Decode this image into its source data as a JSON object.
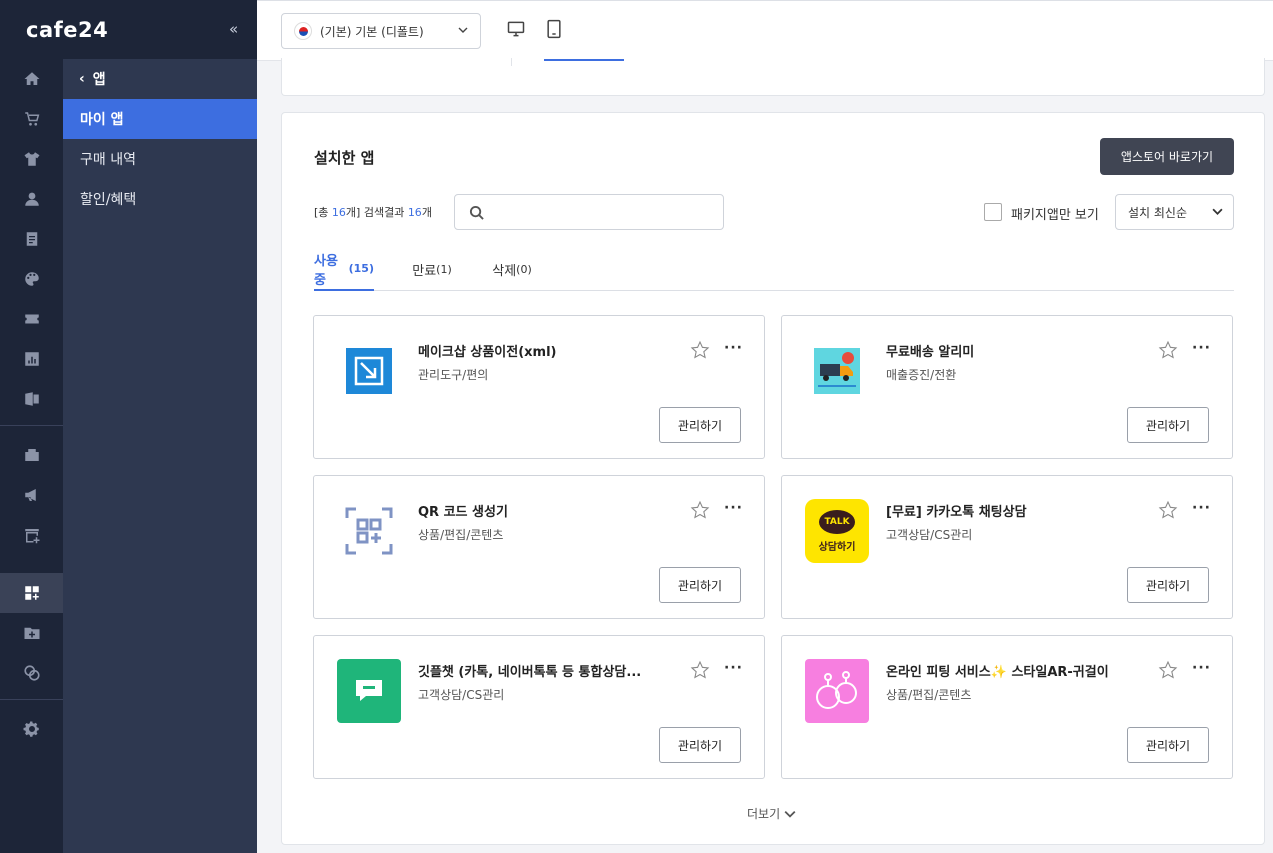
{
  "brand": {
    "logo": "cafe24",
    "collapse_glyph": "«"
  },
  "rail": {
    "icons": [
      "home-icon",
      "cart-icon",
      "shirt-icon",
      "user-icon",
      "document-icon",
      "palette-icon",
      "coupon-icon",
      "chart-icon",
      "excel-icon",
      "store-icon",
      "megaphone-icon",
      "shop-add-icon",
      "apps-icon",
      "folder-add-icon",
      "layers-icon",
      "gear-icon"
    ],
    "active": "apps-icon"
  },
  "subnav": {
    "back_label": "앱",
    "items": [
      {
        "label": "마이 앱",
        "active": true
      },
      {
        "label": "구매 내역",
        "active": false
      },
      {
        "label": "할인/혜택",
        "active": false
      }
    ]
  },
  "topbar": {
    "language_select": "(기본) 기본 (디폴트)",
    "devices": [
      "desktop-icon",
      "mobile-icon"
    ]
  },
  "main": {
    "title": "설치한 앱",
    "store_button": "앱스토어 바로가기",
    "count": {
      "prefix": "[총 ",
      "total": "16",
      "mid": "개] 검색결과 ",
      "results": "16",
      "suffix": "개"
    },
    "search_placeholder": "",
    "package_only_label": "패키지앱만 보기",
    "sort_value": "설치 최신순",
    "tabs": [
      {
        "label": "사용중",
        "count": "(15)",
        "active": true
      },
      {
        "label": "만료",
        "count": "(1)",
        "active": false
      },
      {
        "label": "삭제",
        "count": "(0)",
        "active": false
      }
    ],
    "apps": [
      {
        "name": "메이크샵 상품이전(xml)",
        "category": "관리도구/편의",
        "manage": "관리하기",
        "icon": "transfer-icon",
        "icon_color": "#1e88d8"
      },
      {
        "name": "무료배송 알리미",
        "category": "매출증진/전환",
        "manage": "관리하기",
        "icon": "truck-icon",
        "icon_color": "#5fd6e0"
      },
      {
        "name": "QR 코드 생성기",
        "category": "상품/편집/콘텐츠",
        "manage": "관리하기",
        "icon": "qr-icon",
        "icon_color": "#ffffff"
      },
      {
        "name": "[무료] 카카오톡 채팅상담",
        "category": "고객상담/CS관리",
        "manage": "관리하기",
        "icon": "kakao-talk-icon",
        "icon_color": "#fee500",
        "icon_text_top": "TALK",
        "icon_text_bottom": "상담하기"
      },
      {
        "name": "깃플챗 (카톡, 네이버톡톡 등 통합상담...",
        "category": "고객상담/CS관리",
        "manage": "관리하기",
        "icon": "chat-bubble-icon",
        "icon_color": "#1fb57a"
      },
      {
        "name": "온라인 피팅 서비스✨ 스타일AR-귀걸이",
        "category": "상품/편집/콘텐츠",
        "manage": "관리하기",
        "icon": "earring-icon",
        "icon_color": "#f77fe0"
      }
    ],
    "more_label": "더보기"
  }
}
